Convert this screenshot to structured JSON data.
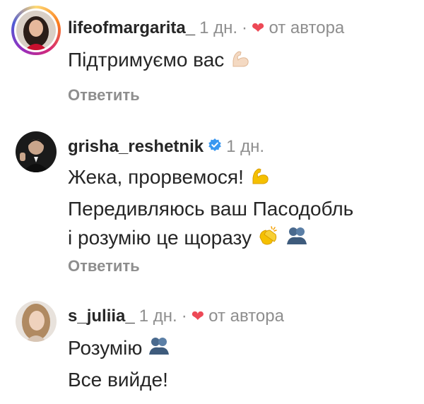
{
  "comments": [
    {
      "username": "lifeofmargarita_",
      "time": "1 дн.",
      "separator": "·",
      "liked_by_author": "от автора",
      "lines": [
        "Підтримуємо вас"
      ],
      "reply_label": "Ответить"
    },
    {
      "username": "grisha_reshetnik",
      "time": "1 дн.",
      "lines": [
        "Жека, прорвемося!",
        "Передивляюсь ваш Пасодобль",
        "і розумію це щоразу"
      ],
      "reply_label": "Ответить"
    },
    {
      "username": "s_juliia_",
      "time": "1 дн.",
      "separator": "·",
      "liked_by_author": "от автора",
      "lines": [
        "Розумію",
        "Все вийде!"
      ]
    }
  ],
  "colors": {
    "text": "#262626",
    "muted": "#8e8e8e",
    "heart": "#ed4956",
    "verified": "#3897f0"
  }
}
